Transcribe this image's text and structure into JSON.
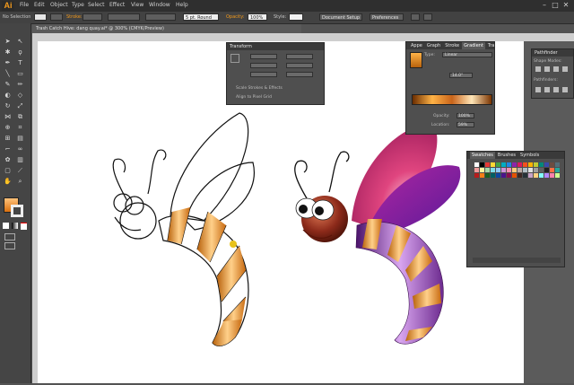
{
  "app": {
    "logo": "Ai",
    "menus": [
      "File",
      "Edit",
      "Object",
      "Type",
      "Select",
      "Effect",
      "View",
      "Window",
      "Help"
    ],
    "window_controls": [
      "–",
      "□",
      "✕"
    ]
  },
  "control_bar": {
    "selection_label": "No Selection",
    "stroke_label": "Stroke:",
    "brush_value": "5 pt. Round",
    "opacity_label": "Opacity:",
    "opacity_value": "100%",
    "style_label": "Style:",
    "document_setup": "Document Setup",
    "preferences": "Preferences"
  },
  "document": {
    "tab_title": "Trash Catch Hive: dang quay.ai* @ 300% (CMYK/Preview)"
  },
  "transform_panel": {
    "title": "Transform",
    "options": [
      "Scale Strokes & Effects",
      "Align to Pixel Grid"
    ]
  },
  "gradient_panel": {
    "tabs": [
      "Appe",
      "Graph",
      "Stroke",
      "Gradient",
      "Trans"
    ],
    "active_tab": "Gradient",
    "type_label": "Type:",
    "type_value": "Linear",
    "angle_value": "14.0°",
    "opacity_label": "Opacity:",
    "opacity_value": "100%",
    "location_label": "Location:",
    "location_value": "59%",
    "ramp_colors": [
      "#6b2d00",
      "#ffb347",
      "#c9641a",
      "#ffe6b8",
      "#7a3300"
    ]
  },
  "pathfinder_panel": {
    "title": "Pathfinder",
    "shape_modes_label": "Shape Modes:",
    "pathfinders_label": "Pathfinders:"
  },
  "swatches_panel": {
    "tabs": [
      "Swatches",
      "Brushes",
      "Symbols"
    ],
    "active_tab": "Swatches"
  },
  "colors": {
    "accent_orange": "#f39a1c",
    "wing_magenta": "#c2185b",
    "wing_violet": "#8e24aa",
    "body_orange": "#e88a18",
    "body_purple": "#7b2a9a"
  }
}
